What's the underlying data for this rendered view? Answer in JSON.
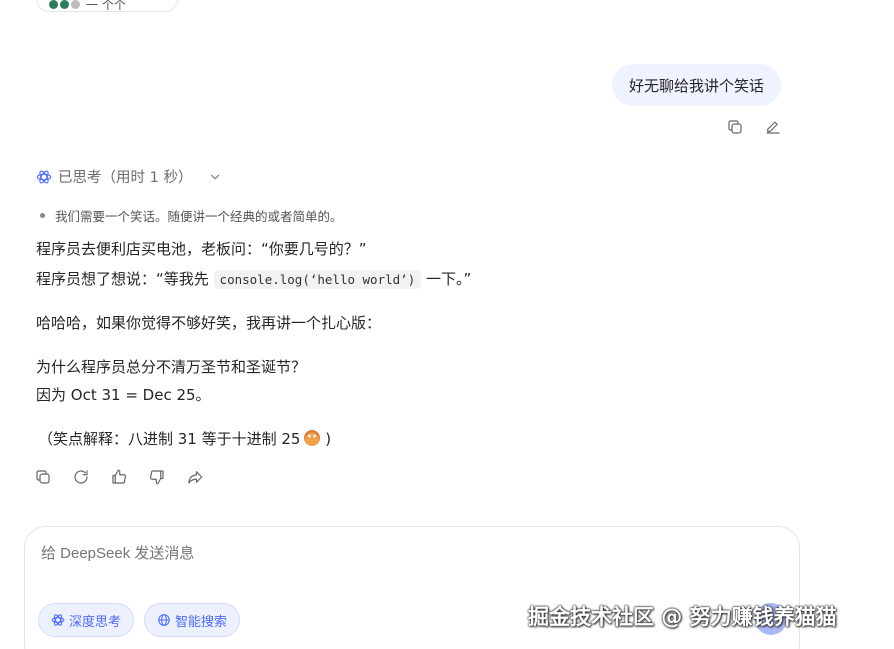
{
  "top_pill": {
    "text": "一 个个"
  },
  "user_message": {
    "text": "好无聊给我讲个笑话"
  },
  "thinking": {
    "label": "已思考（用时 1 秒）"
  },
  "thought_item": {
    "text": "我们需要一个笑话。随便讲一个经典的或者简单的。"
  },
  "answer": {
    "line1": "程序员去便利店买电池，老板问：“你要几号的？”",
    "line2_before": "程序员想了想说：“等我先 ",
    "line2_code": "console.log(‘hello world’)",
    "line2_after": " 一下。”",
    "line3": "哈哈哈，如果你觉得不够好笑，我再讲一个扎心版：",
    "line4": "为什么程序员总分不清万圣节和圣诞节？",
    "line5": "因为 Oct 31 = Dec 25。",
    "line6": "（笑点解释：八进制 31 等于十进制 25"
  },
  "input": {
    "placeholder": "给 DeepSeek 发送消息",
    "deep_think_label": "深度思考",
    "search_label": "智能搜索"
  },
  "watermark": {
    "text": "掘金技术社区 @ 努力赚钱养猫猫"
  },
  "colors": {
    "accent": "#4d6bfe",
    "user_bubble": "#eff3ff"
  }
}
